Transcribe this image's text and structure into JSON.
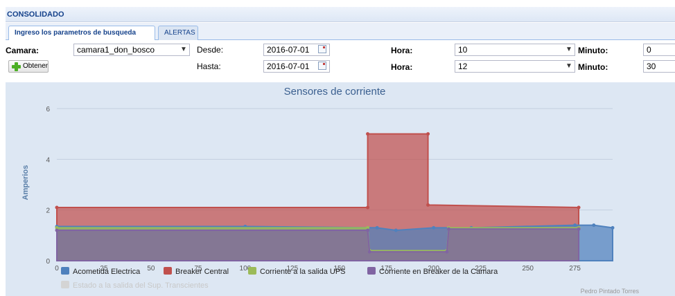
{
  "panel": {
    "title": "CONSOLIDADO"
  },
  "tabs": [
    {
      "label": "Ingreso los parametros de busqueda",
      "active": true
    },
    {
      "label": "ALERTAS",
      "active": false
    }
  ],
  "form": {
    "camara_label": "Camara:",
    "camara_value": "camara1_don_bosco",
    "desde_label": "Desde:",
    "desde_value": "2016-07-01",
    "hasta_label": "Hasta:",
    "hasta_value": "2016-07-01",
    "hora_label": "Hora:",
    "hora_desde_value": "10",
    "hora_hasta_value": "12",
    "minuto_label": "Minuto:",
    "minuto_desde_value": "0",
    "minuto_hasta_value": "30",
    "obtener_label": "Obtener"
  },
  "colors": {
    "acometida": "#4f81bd",
    "breaker": "#c0504d",
    "ups": "#9bbb59",
    "camara": "#8064a2",
    "estado": "#cccccc",
    "chart_bg": "#dde7f3"
  },
  "chart_data": {
    "type": "area",
    "title": "Sensores de corriente",
    "ylabel": "Amperios",
    "xlabel": "",
    "xlim": [
      0,
      295
    ],
    "ylim": [
      0,
      6
    ],
    "x_ticks": [
      0,
      25,
      50,
      75,
      100,
      125,
      150,
      175,
      200,
      225,
      250,
      275
    ],
    "y_ticks": [
      0,
      2,
      4,
      6
    ],
    "grid": true,
    "legend_position": "bottom",
    "series": [
      {
        "name": "Acometida Electrica",
        "color": "#4f81bd",
        "visible": true,
        "points": [
          [
            0,
            1.35
          ],
          [
            100,
            1.35
          ],
          [
            170,
            1.3
          ],
          [
            180,
            1.2
          ],
          [
            200,
            1.3
          ],
          [
            220,
            1.3
          ],
          [
            275,
            1.4
          ],
          [
            285,
            1.4
          ],
          [
            295,
            1.3
          ]
        ]
      },
      {
        "name": "Breaker Central",
        "color": "#c0504d",
        "visible": true,
        "points": [
          [
            0,
            2.1
          ],
          [
            165,
            2.1
          ],
          [
            165,
            5.0
          ],
          [
            197,
            5.0
          ],
          [
            197,
            2.2
          ],
          [
            277,
            2.1
          ]
        ]
      },
      {
        "name": "Corriente a la salida UPS",
        "color": "#9bbb59",
        "visible": true,
        "points": [
          [
            0,
            1.3
          ],
          [
            165,
            1.3
          ],
          [
            166,
            0.4
          ],
          [
            207,
            0.4
          ],
          [
            208,
            1.3
          ],
          [
            277,
            1.3
          ]
        ]
      },
      {
        "name": "Corriente en Breaker de la Camara",
        "color": "#8064a2",
        "visible": true,
        "points": [
          [
            0,
            1.2
          ],
          [
            165,
            1.2
          ],
          [
            166,
            0.35
          ],
          [
            207,
            0.35
          ],
          [
            208,
            1.25
          ],
          [
            277,
            1.25
          ]
        ]
      },
      {
        "name": "Estado a la salida del Sup. Transcientes",
        "color": "#cccccc",
        "visible": false,
        "points": []
      }
    ],
    "credits": "Pedro Pintado Torres"
  }
}
